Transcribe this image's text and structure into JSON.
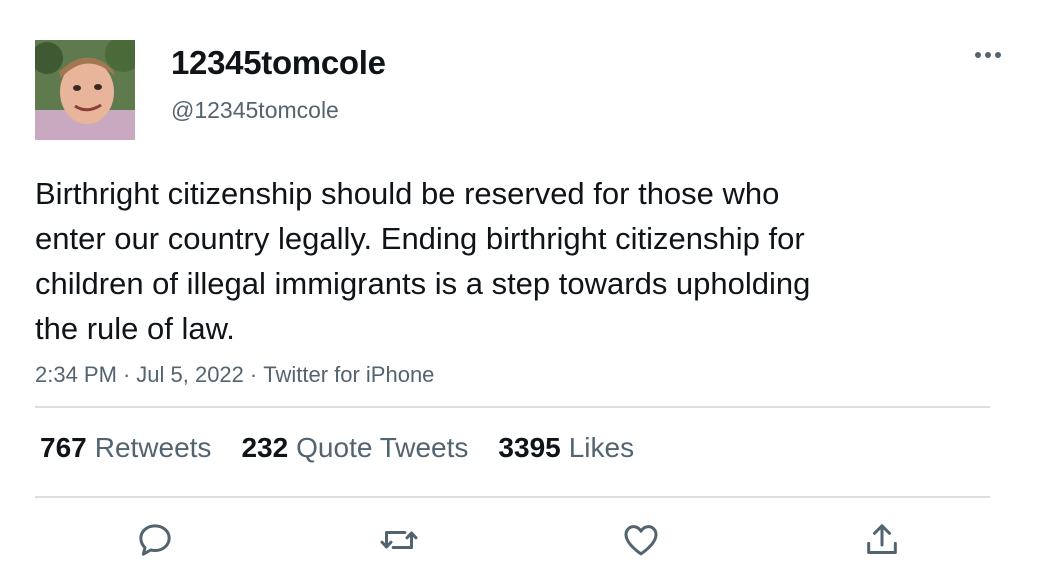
{
  "user": {
    "display_name": "12345tomcole",
    "handle": "@12345tomcole",
    "avatar_icon": "profile-photo"
  },
  "tweet": {
    "text": "Birthright citizenship should be reserved for those who enter our country legally. Ending birthright citizenship for children of illegal immigrants is a step towards upholding the rule of law.",
    "time": "2:34 PM",
    "separator": "·",
    "date": "Jul 5, 2022",
    "source": "Twitter for iPhone"
  },
  "stats": {
    "retweets_count": "767",
    "retweets_label": "Retweets",
    "quotes_count": "232",
    "quotes_label": "Quote Tweets",
    "likes_count": "3395",
    "likes_label": "Likes"
  },
  "actions": {
    "reply_icon": "reply-icon",
    "retweet_icon": "retweet-icon",
    "like_icon": "heart-icon",
    "share_icon": "share-icon",
    "more_icon": "more-icon"
  },
  "colors": {
    "text_primary": "#0f1419",
    "text_secondary": "#536471",
    "icon": "#536471",
    "divider": "#dcdfe2"
  }
}
